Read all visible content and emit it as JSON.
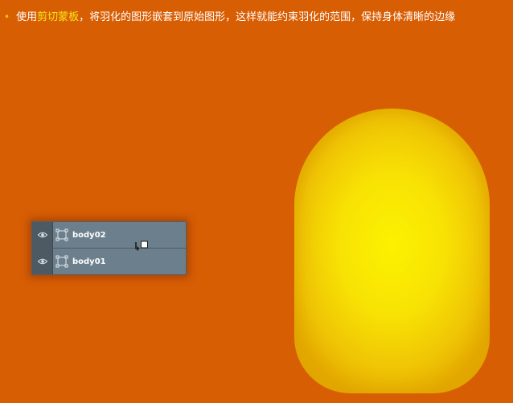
{
  "instruction": {
    "prefix": "使用",
    "highlight": "剪切蒙板",
    "suffix": "，将羽化的图形嵌套到原始图形，这样就能约束羽化的范围，保持身体清晰的边缘"
  },
  "layers": [
    {
      "name": "body02",
      "visible": true,
      "icon": "eye-icon",
      "thumbnail": "shape-layer-icon"
    },
    {
      "name": "body01",
      "visible": true,
      "icon": "eye-icon",
      "thumbnail": "shape-layer-icon"
    }
  ],
  "colors": {
    "background": "#d85e04",
    "highlight_text": "#f8e51c",
    "panel": "#6c7f8d",
    "shape_center": "#fcf200",
    "shape_edge": "#e4a900"
  }
}
